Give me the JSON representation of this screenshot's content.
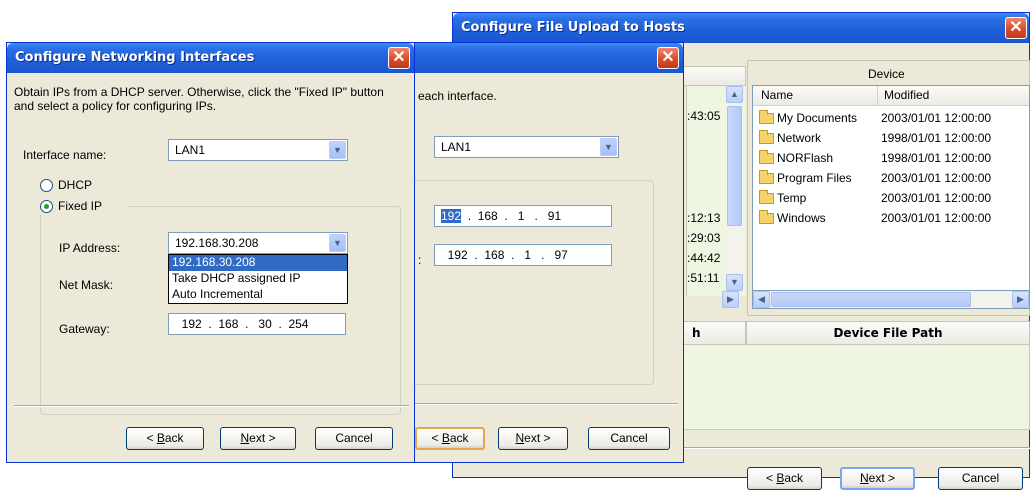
{
  "upload_window": {
    "title": "Configure File Upload to Hosts",
    "close_label": "✕",
    "device_panel": {
      "group_label": "Device",
      "columns": [
        "Name",
        "Modified"
      ],
      "rows": [
        {
          "name": "My Documents",
          "modified": "2003/01/01 12:00:00"
        },
        {
          "name": "Network",
          "modified": "1998/01/01 12:00:00"
        },
        {
          "name": "NORFlash",
          "modified": "1998/01/01 12:00:00"
        },
        {
          "name": "Program Files",
          "modified": "2003/01/01 12:00:00"
        },
        {
          "name": "Temp",
          "modified": "2003/01/01 12:00:00"
        },
        {
          "name": "Windows",
          "modified": "2003/01/01 12:00:00"
        }
      ]
    },
    "host_times": [
      ":43:05",
      ":12:13",
      ":29:03",
      ":44:42",
      ":51:11"
    ],
    "path_header_left": "h",
    "path_header_right": "Device File Path",
    "buttons": {
      "back_prefix": "< ",
      "back_u": "B",
      "back_rest": "ack",
      "next_u": "N",
      "next_rest": "ext >",
      "cancel": "Cancel"
    }
  },
  "middle_window": {
    "instruction_fragment": "each interface.",
    "interface_value": "LAN1",
    "ip_address": {
      "a": "192",
      "b": "168",
      "c": "1",
      "d": "91"
    },
    "gateway": {
      "a": "192",
      "b": "168",
      "c": "1",
      "d": "97"
    },
    "gateway_label_fragment": ":",
    "close_label": "✕",
    "buttons": {
      "back_prefix": "< ",
      "back_u": "B",
      "back_rest": "ack",
      "next_u": "N",
      "next_rest": "ext >",
      "cancel": "Cancel"
    }
  },
  "net_window": {
    "title": "Configure Networking Interfaces",
    "close_label": "✕",
    "instructions": "Obtain IPs from a DHCP server. Otherwise, click the \"Fixed IP\" button  and select a policy for configuring  IPs.",
    "interface_label": "Interface name:",
    "interface_value": "LAN1",
    "dhcp_label": "DHCP",
    "fixed_ip_label": "Fixed IP",
    "ip_address_label": "IP Address:",
    "ip_address_value": "192.168.30.208",
    "dropdown_options": [
      "192.168.30.208",
      "Take DHCP assigned IP",
      "Auto Incremental"
    ],
    "net_mask_label": "Net Mask:",
    "gateway_label": "Gateway:",
    "gateway": {
      "a": "192",
      "b": "168",
      "c": "30",
      "d": "254"
    },
    "buttons": {
      "back_prefix": "< ",
      "back_u": "B",
      "back_rest": "ack",
      "next_u": "N",
      "next_rest": "ext >",
      "cancel": "Cancel"
    }
  }
}
